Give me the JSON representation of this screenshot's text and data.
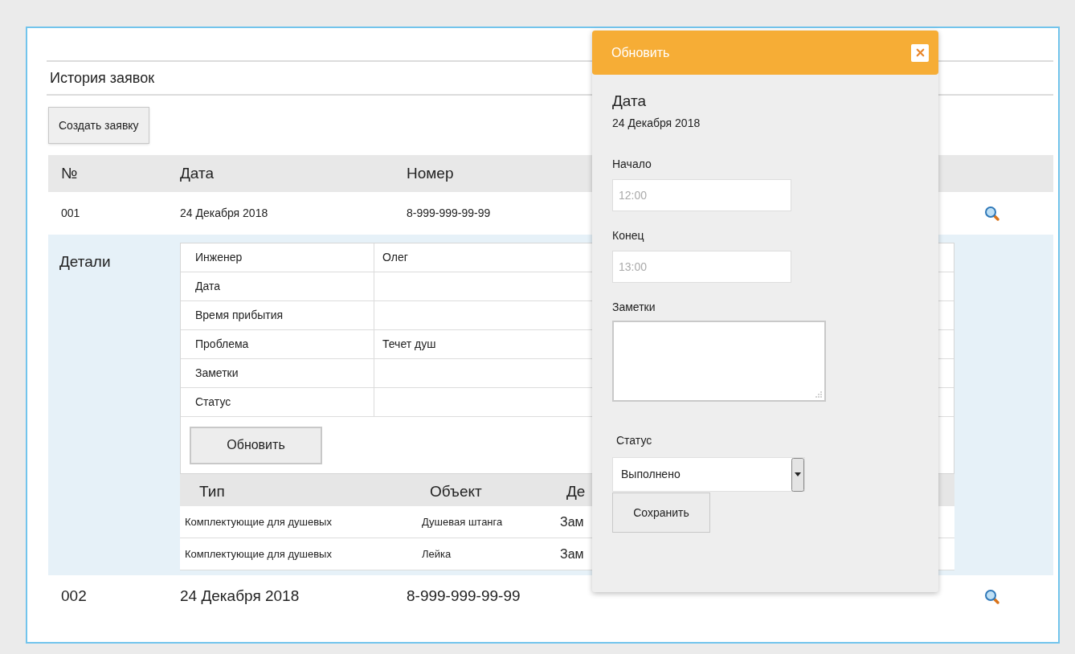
{
  "page": {
    "title": "История заявок",
    "create_button": "Создать заявку"
  },
  "table": {
    "columns": [
      "№",
      "Дата",
      "Номер"
    ],
    "rows": [
      {
        "cells": [
          "001",
          "24 Декабря 2018",
          "8-999-999-99-99"
        ]
      },
      {
        "cells": [
          "002",
          "24 Декабря 2018",
          "8-999-999-99-99"
        ]
      }
    ]
  },
  "details": {
    "label": "Детали",
    "fields": [
      {
        "label": "Инженер",
        "value": "Олег"
      },
      {
        "label": "Дата"
      },
      {
        "label": "Время прибытия"
      },
      {
        "label": "Проблема",
        "value": "Течет душ"
      },
      {
        "label": "Заметки"
      },
      {
        "label": "Статус"
      }
    ],
    "update_button": "Обновить",
    "items": {
      "columns": [
        "Тип",
        "Объект",
        "Де"
      ],
      "rows": [
        [
          "Комплектующие для душевых",
          "Душевая штанга",
          "Зам"
        ],
        [
          "Комплектующие для душевых",
          "Лейка",
          "Зам"
        ]
      ]
    }
  },
  "modal": {
    "title": "Обновить",
    "date_label": "Дата",
    "date": "24 Декабря 2018",
    "fields": [
      {
        "label": "Начало",
        "placeholder": "12:00"
      },
      {
        "label": "Конец",
        "placeholder": "13:00"
      }
    ],
    "notes_label": "Заметки",
    "status_label": "Статус",
    "status_value": "Выполнено",
    "save_button": "Сохранить"
  }
}
